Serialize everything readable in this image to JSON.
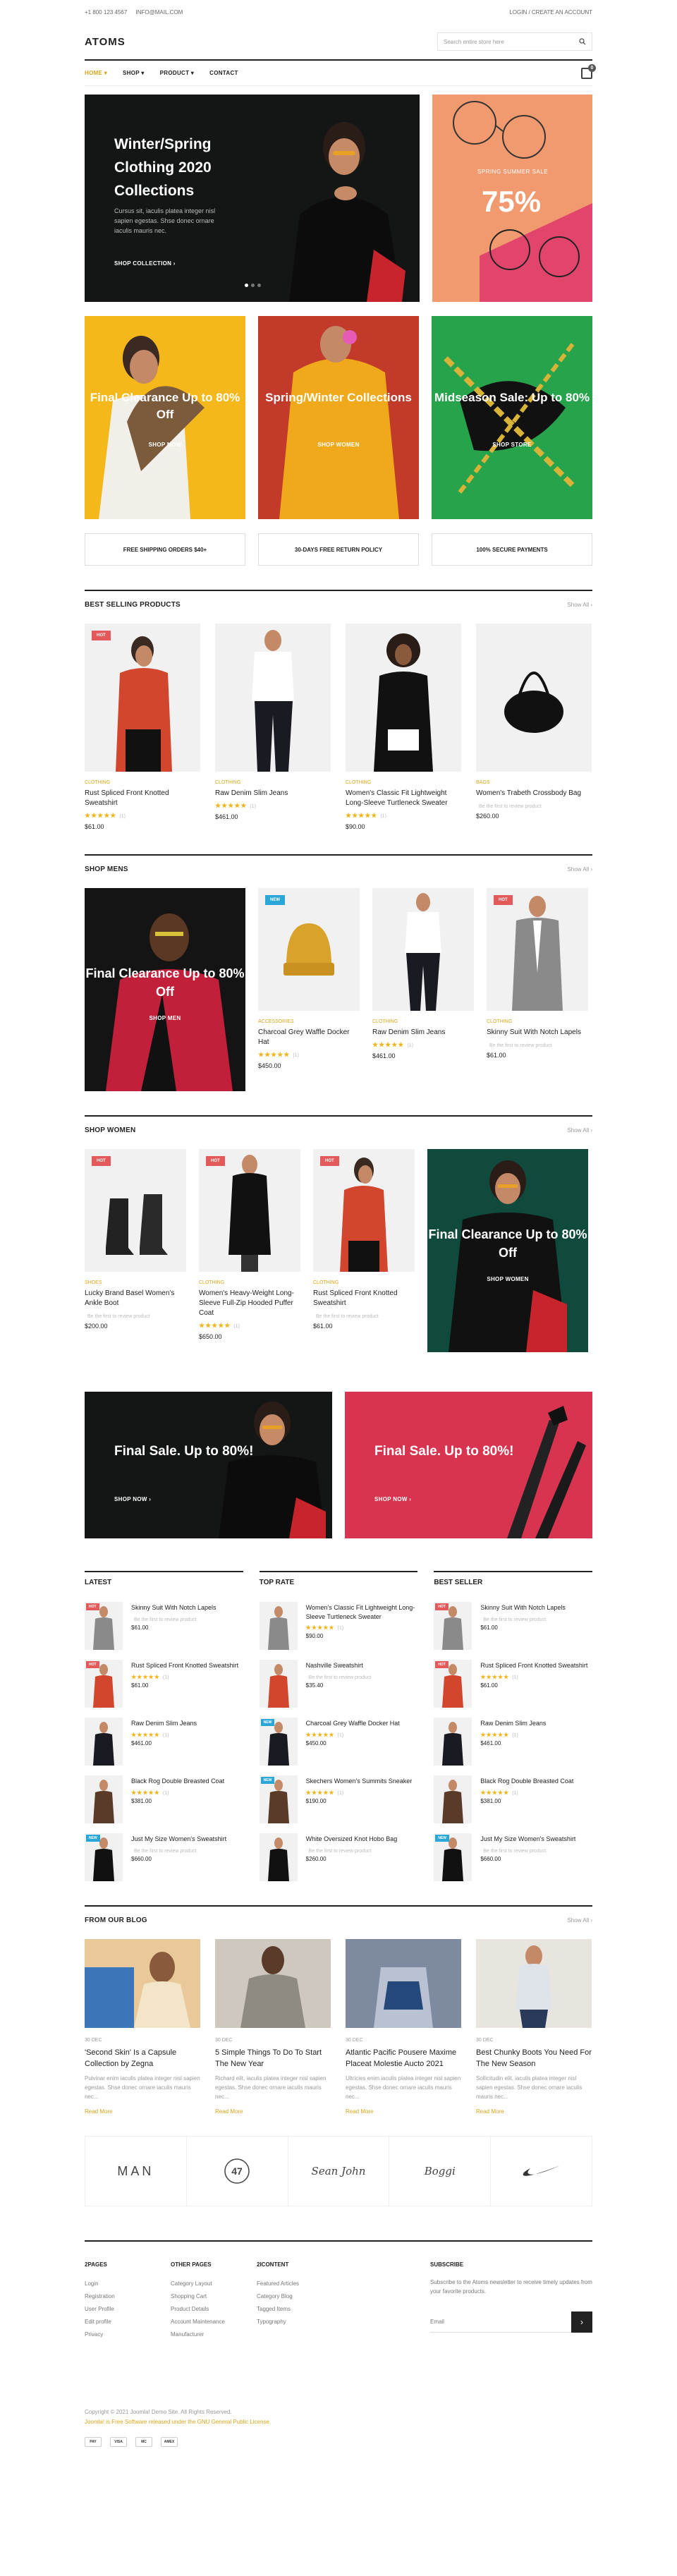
{
  "topbar": {
    "phone": "+1 800 123 4567",
    "email": "INFO@MAIL.COM",
    "account": "LOGIN / CREATE AN ACCOUNT"
  },
  "header": {
    "logo": "ATOMS",
    "search_placeholder": "Search entire store here"
  },
  "nav": {
    "items": [
      "HOME",
      "SHOP",
      "PRODUCT",
      "CONTACT"
    ],
    "cart_count": "0"
  },
  "hero": {
    "title": "Winter/Spring Clothing 2020 Collections",
    "text": "Cursus sit, iaculis platea integer nisl sapien egestas. Shse donec ornare iaculis mauris nec.",
    "cta": "SHOP COLLECTION",
    "side_small": "SPRING SUMMER SALE",
    "side_big": "75%"
  },
  "promos": [
    {
      "title": "Final Clearance Up to 80% Off",
      "cta": "SHOP NOW",
      "bg": "#f5b81a"
    },
    {
      "title": "Spring/Winter Collections",
      "cta": "SHOP WOMEN",
      "bg": "#f0a91a"
    },
    {
      "title": "Midseason Sale: Up to 80%",
      "cta": "SHOP STORE",
      "bg": "#27a34b"
    }
  ],
  "features": [
    "FREE SHIPPING ORDERS $40+",
    "30-DAYS FREE RETURN POLICY",
    "100% SECURE PAYMENTS"
  ],
  "best": {
    "title": "BEST SELLING PRODUCTS",
    "link": "Show All",
    "items": [
      {
        "badge": "HOT",
        "cat": "CLOTHING",
        "name": "Rust Spliced Front Knotted Sweatshirt",
        "stars": "★★★★★",
        "reviews": "(1)",
        "price": "$61.00"
      },
      {
        "badge": "",
        "cat": "CLOTHING",
        "name": "Raw Denim Slim Jeans",
        "stars": "★★★★★",
        "reviews": "(1)",
        "price": "$461.00"
      },
      {
        "badge": "",
        "cat": "CLOTHING",
        "name": "Women's Classic Fit Lightweight Long-Sleeve Turtleneck Sweater",
        "stars": "★★★★★",
        "reviews": "(1)",
        "price": "$90.00"
      },
      {
        "badge": "",
        "cat": "BAGS",
        "name": "Women's Trabeth Crossbody Bag",
        "stars": "",
        "reviews": "Be the first to review product",
        "price": "$260.00"
      }
    ]
  },
  "men": {
    "title": "SHOP MENS",
    "link": "Show All",
    "banner": "Final Clearance Up to 80% Off",
    "cta": "SHOP MEN",
    "items": [
      {
        "badge": "NEW",
        "cat": "ACCESSORIES",
        "name": "Charcoal Grey Waffle Docker Hat",
        "stars": "★★★★★",
        "reviews": "(1)",
        "price": "$450.00"
      },
      {
        "badge": "",
        "cat": "CLOTHING",
        "name": "Raw Denim Slim Jeans",
        "stars": "★★★★★",
        "reviews": "(1)",
        "price": "$461.00"
      },
      {
        "badge": "HOT",
        "cat": "CLOTHING",
        "name": "Skinny Suit With Notch Lapels",
        "stars": "",
        "reviews": "Be the first to review product",
        "price": "$61.00"
      }
    ]
  },
  "women": {
    "title": "SHOP WOMEN",
    "link": "Show All",
    "banner": "Final Clearance Up to 80% Off",
    "cta": "SHOP WOMEN",
    "items": [
      {
        "badge": "HOT",
        "cat": "SHOES",
        "name": "Lucky Brand Basel Women's Ankle Boot",
        "stars": "",
        "reviews": "Be the first to review product",
        "price": "$200.00"
      },
      {
        "badge": "HOT",
        "cat": "CLOTHING",
        "name": "Women's Heavy-Weight Long-Sleeve Full-Zip Hooded Puffer Coat",
        "stars": "★★★★★",
        "reviews": "(1)",
        "price": "$650.00"
      },
      {
        "badge": "HOT",
        "cat": "CLOTHING",
        "name": "Rust Spliced Front Knotted Sweatshirt",
        "stars": "",
        "reviews": "Be the first to review product",
        "price": "$61.00"
      }
    ]
  },
  "sales": [
    {
      "title": "Final Sale. Up to 80%!",
      "cta": "SHOP NOW"
    },
    {
      "title": "Final Sale. Up to 80%!",
      "cta": "SHOP NOW"
    }
  ],
  "lists": [
    {
      "title": "LATEST",
      "items": [
        {
          "badge": "HOT",
          "name": "Skinny Suit With Notch Lapels",
          "stars": "",
          "rev": "Be the first to review product",
          "price": "$61.00"
        },
        {
          "badge": "HOT",
          "name": "Rust Spliced Front Knotted Sweatshirt",
          "stars": "★★★★★",
          "rev": "(1)",
          "price": "$61.00"
        },
        {
          "badge": "",
          "name": "Raw Denim Slim Jeans",
          "stars": "★★★★★",
          "rev": "(1)",
          "price": "$461.00"
        },
        {
          "badge": "",
          "name": "Black Rog Double Breasted Coat",
          "stars": "★★★★★",
          "rev": "(1)",
          "price": "$381.00"
        },
        {
          "badge": "NEW",
          "name": "Just My Size Women's Sweatshirt",
          "stars": "",
          "rev": "Be the first to review product",
          "price": "$660.00"
        }
      ]
    },
    {
      "title": "TOP RATE",
      "items": [
        {
          "badge": "",
          "name": "Women's Classic Fit Lightweight Long-Sleeve Turtleneck Sweater",
          "stars": "★★★★★",
          "rev": "(1)",
          "price": "$90.00"
        },
        {
          "badge": "",
          "name": "Nashville Sweatshirt",
          "stars": "",
          "rev": "Be the first to review product",
          "price": "$35.40"
        },
        {
          "badge": "NEW",
          "name": "Charcoal Grey Waffle Docker Hat",
          "stars": "★★★★★",
          "rev": "(1)",
          "price": "$450.00"
        },
        {
          "badge": "NEW",
          "name": "Skechers Women's Summits Sneaker",
          "stars": "★★★★★",
          "rev": "(1)",
          "price": "$190.00"
        },
        {
          "badge": "",
          "name": "White Oversized Knot Hobo Bag",
          "stars": "",
          "rev": "Be the first to review product",
          "price": "$260.00"
        }
      ]
    },
    {
      "title": "BEST SELLER",
      "items": [
        {
          "badge": "HOT",
          "name": "Skinny Suit With Notch Lapels",
          "stars": "",
          "rev": "Be the first to review product",
          "price": "$61.00"
        },
        {
          "badge": "HOT",
          "name": "Rust Spliced Front Knotted Sweatshirt",
          "stars": "★★★★★",
          "rev": "(1)",
          "price": "$61.00"
        },
        {
          "badge": "",
          "name": "Raw Denim Slim Jeans",
          "stars": "★★★★★",
          "rev": "(1)",
          "price": "$461.00"
        },
        {
          "badge": "",
          "name": "Black Rog Double Breasted Coat",
          "stars": "★★★★★",
          "rev": "(1)",
          "price": "$381.00"
        },
        {
          "badge": "NEW",
          "name": "Just My Size Women's Sweatshirt",
          "stars": "",
          "rev": "Be the first to review product",
          "price": "$660.00"
        }
      ]
    }
  ],
  "blog": {
    "title": "FROM OUR BLOG",
    "link": "Show All",
    "posts": [
      {
        "date": "30 DEC",
        "title": "'Second Skin' Is a Capsule Collection by Zegna",
        "excerpt": "Pulvinar enim iaculis platea integer nisl sapien egestas. Shse donec ornare iaculis mauris nec...",
        "more": "Read More"
      },
      {
        "date": "30 DEC",
        "title": "5 Simple Things To Do To Start The New Year",
        "excerpt": "Richard elit, iaculis platea integer nisl sapien egestas. Shse donec ornare iaculis mauris nec...",
        "more": "Read More"
      },
      {
        "date": "30 DEC",
        "title": "Atlantic Pacific Pousere Maxime Placeat Molestie Aucto 2021",
        "excerpt": "Ultricies enim iaculis platea integer nisl sapien egestas. Shse donec ornare iaculis mauris nec...",
        "more": "Read More"
      },
      {
        "date": "30 DEC",
        "title": "Best Chunky Boots You Need For The New Season",
        "excerpt": "Sollicitudin elit, iaculis platea integer nisl sapien egestas. Shse donec ornare iaculis mauris nec...",
        "more": "Read More"
      }
    ]
  },
  "brands": [
    "MAN",
    "47",
    "Sean John",
    "Boggi",
    "Nike"
  ],
  "footer": {
    "cols": [
      {
        "title": "2PAGES",
        "links": [
          "Login",
          "Registration",
          "User Profile",
          "Edit profile",
          "Privacy"
        ]
      },
      {
        "title": "OTHER PAGES",
        "links": [
          "Category Layout",
          "Shopping Cart",
          "Product Details",
          "Account Maintenance",
          "Manufacturer"
        ]
      },
      {
        "title": "2ICONTENT",
        "links": [
          "Featured Articles",
          "Category Blog",
          "Tagged Items",
          "Typography"
        ]
      }
    ],
    "subscribe_title": "SUBSCRIBE",
    "subscribe_text": "Subscribe to the Atoms newsletter to receive timely updates from your favorite products.",
    "email_placeholder": "Email",
    "copyright": "Copyright © 2021 Joomla! Demo Site. All Rights Reserved.",
    "license": "Joomla! is Free Software released under the GNU General Public License.",
    "payments": [
      "PAY",
      "VISA",
      "MC",
      "AMEX"
    ]
  }
}
